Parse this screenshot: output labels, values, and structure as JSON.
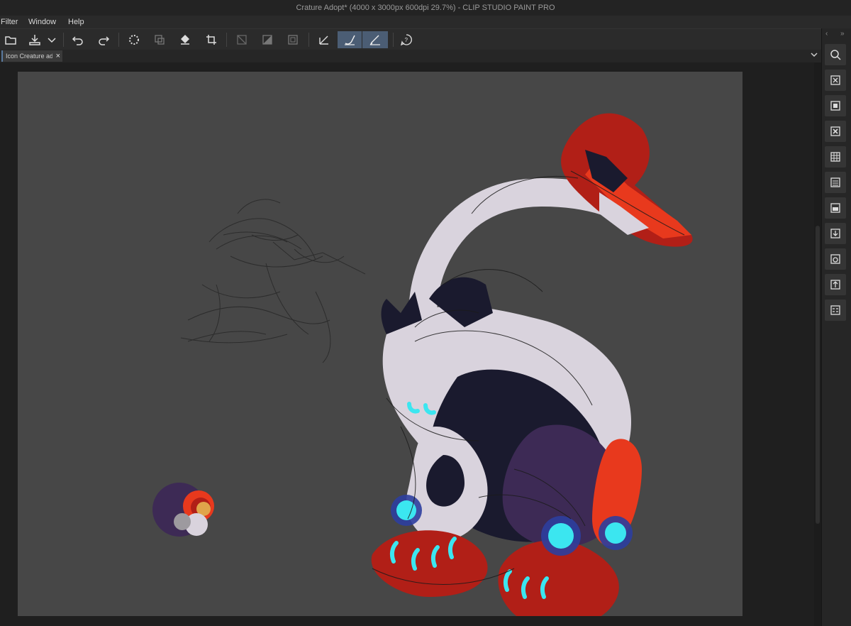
{
  "window": {
    "title": "Crature Adopt* (4000 x 3000px 600dpi 29.7%)  - CLIP STUDIO PAINT PRO"
  },
  "menu": [
    "Filter",
    "Window",
    "Help"
  ],
  "toolbar": {
    "icons": [
      "open-file-icon",
      "save-icon",
      "dropdown-icon",
      "undo-icon",
      "redo-icon",
      "loading-icon",
      "layer-icon",
      "fill-icon",
      "crop-icon",
      "clear-icon",
      "tone-icon",
      "frame-icon",
      "pen-icon",
      "brush-icon",
      "ruler-pen-icon",
      "help-icon"
    ]
  },
  "tab": {
    "label": "Icon Creature adopt",
    "close": "×"
  },
  "right_panel": {
    "collapse_left": "‹",
    "expand": "»",
    "icons": [
      "search-icon",
      "file-x-icon",
      "file-icon",
      "file-x2-icon",
      "grid-icon",
      "list-icon",
      "folder-icon",
      "download-icon",
      "camera-icon",
      "user-icon",
      "gallery-icon"
    ]
  },
  "colors": {
    "accent": "#4b5d74",
    "canvas": "#474747",
    "red": "#e8391d",
    "cyan": "#3be6f0",
    "purple": "#3d2a55"
  }
}
